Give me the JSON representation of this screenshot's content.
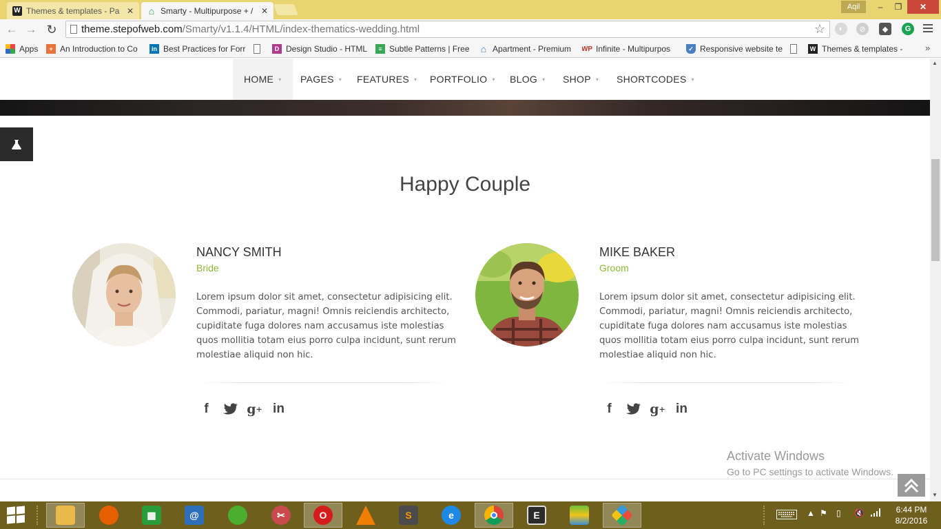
{
  "browser": {
    "tabs": [
      {
        "title": "Themes & templates - Pa",
        "favicon_text": "W",
        "active": false
      },
      {
        "title": "Smarty - Multipurpose + /",
        "favicon_text": "⌂",
        "active": true
      }
    ],
    "user": "Aqil",
    "window_controls": {
      "minimize": "–",
      "maximize": "❐",
      "close": "✕"
    },
    "url_host": "theme.stepofweb.com",
    "url_path": "/Smarty/v1.1.4/HTML/index-thematics-wedding.html",
    "bookmarks": [
      {
        "label": "Apps",
        "icon": "apps-grid-icon",
        "color": "#e44"
      },
      {
        "label": "An Introduction to Co",
        "icon": "plus-icon",
        "color": "#e8743b"
      },
      {
        "label": "Best Practices for Forr",
        "icon": "linkedin-icon",
        "color": "#0077b5"
      },
      {
        "label": "",
        "icon": "page-icon",
        "color": "#888"
      },
      {
        "label": "Design Studio - HTML",
        "icon": "d-icon",
        "color": "#b03a8c"
      },
      {
        "label": "Subtle Patterns | Free",
        "icon": "pattern-icon",
        "color": "#3aa657"
      },
      {
        "label": "Apartment - Premium",
        "icon": "home-icon",
        "color": "#3b82c4"
      },
      {
        "label": "Infinite - Multipurpos",
        "icon": "wp-icon",
        "color": "#c0392b"
      },
      {
        "label": "Responsive website te",
        "icon": "shield-icon",
        "color": "#4a7fc1"
      },
      {
        "label": "",
        "icon": "page-icon",
        "color": "#888"
      },
      {
        "label": "Themes & templates -",
        "icon": "w-icon",
        "color": "#222"
      }
    ],
    "bookmarks_more": "»"
  },
  "site": {
    "nav": [
      {
        "label": "HOME"
      },
      {
        "label": "PAGES"
      },
      {
        "label": "FEATURES"
      },
      {
        "label": "PORTFOLIO"
      },
      {
        "label": "BLOG"
      },
      {
        "label": "SHOP"
      },
      {
        "label": "SHORTCODES"
      }
    ],
    "section_title": "Happy Couple",
    "people": [
      {
        "name": "NANCY SMITH",
        "role": "Bride",
        "bio": "Lorem ipsum dolor sit amet, consectetur adipisicing elit. Commodi, pariatur, magni! Omnis reiciendis architecto, cupiditate fuga dolores nam accusamus iste molestias quos mollitia totam eius porro culpa incidunt, sunt rerum molestiae aliquid non hic."
      },
      {
        "name": "MIKE BAKER",
        "role": "Groom",
        "bio": "Lorem ipsum dolor sit amet, consectetur adipisicing elit. Commodi, pariatur, magni! Omnis reiciendis architecto, cupiditate fuga dolores nam accusamus iste molestias quos mollitia totam eius porro culpa incidunt, sunt rerum molestiae aliquid non hic."
      }
    ],
    "social_icons": [
      "facebook-icon",
      "twitter-icon",
      "google-plus-icon",
      "linkedin-icon"
    ],
    "colors": {
      "accent": "#8ab933",
      "text": "#555555",
      "heading": "#333333"
    }
  },
  "os": {
    "watermark_title": "Activate Windows",
    "watermark_sub": "Go to PC settings to activate Windows.",
    "clock_time": "6:44 PM",
    "clock_date": "8/2/2016"
  }
}
